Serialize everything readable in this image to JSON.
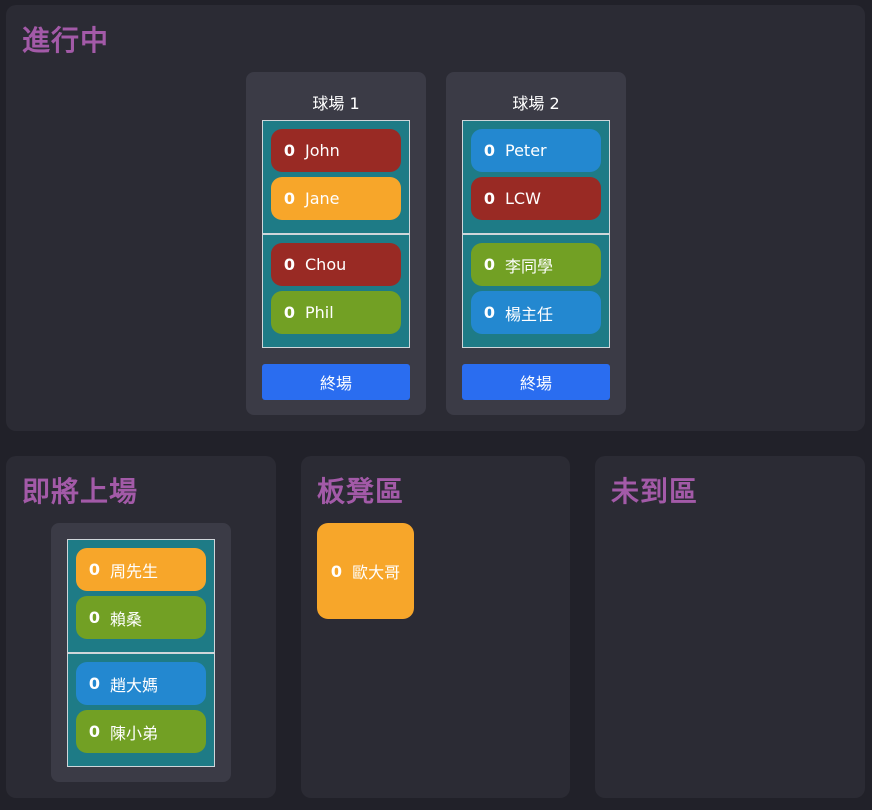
{
  "colors": {
    "red": "#992a24",
    "orange": "#f7a62a",
    "green": "#72a024",
    "blue": "#2388d0",
    "title": "#a35aa8",
    "button": "#2a6df0"
  },
  "in_progress": {
    "title": "進行中",
    "courts": [
      {
        "name": "球場 1",
        "players": [
          {
            "score": "0",
            "name": "John",
            "color": "red"
          },
          {
            "score": "0",
            "name": "Jane",
            "color": "orange"
          },
          {
            "score": "0",
            "name": "Chou",
            "color": "red"
          },
          {
            "score": "0",
            "name": "Phil",
            "color": "green"
          }
        ],
        "end_label": "終場"
      },
      {
        "name": "球場 2",
        "players": [
          {
            "score": "0",
            "name": "Peter",
            "color": "blue"
          },
          {
            "score": "0",
            "name": "LCW",
            "color": "red"
          },
          {
            "score": "0",
            "name": "李同學",
            "color": "green"
          },
          {
            "score": "0",
            "name": "楊主任",
            "color": "blue"
          }
        ],
        "end_label": "終場"
      }
    ]
  },
  "upcoming": {
    "title": "即將上場",
    "players": [
      {
        "score": "0",
        "name": "周先生",
        "color": "orange"
      },
      {
        "score": "0",
        "name": "賴桑",
        "color": "green"
      },
      {
        "score": "0",
        "name": "趙大媽",
        "color": "blue"
      },
      {
        "score": "0",
        "name": "陳小弟",
        "color": "green"
      }
    ]
  },
  "bench": {
    "title": "板凳區",
    "players": [
      {
        "score": "0",
        "name": "歐大哥",
        "color": "orange"
      }
    ]
  },
  "absent": {
    "title": "未到區"
  }
}
